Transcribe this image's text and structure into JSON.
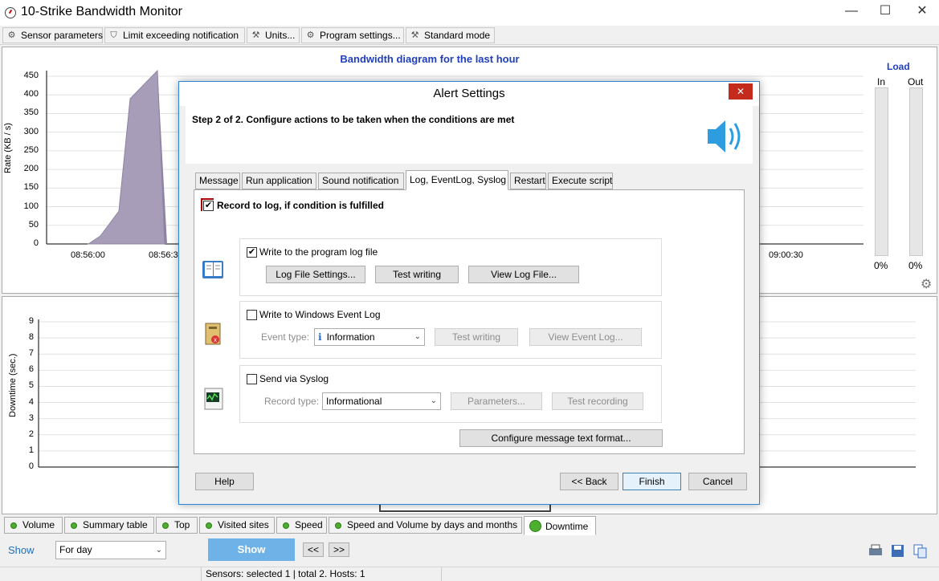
{
  "window": {
    "title": "10-Strike Bandwidth Monitor",
    "minimize": "—",
    "maximize": "☐",
    "close": "✕"
  },
  "toolbar": {
    "items": [
      {
        "label": "Sensor parameters",
        "icon": "gear-icon"
      },
      {
        "label": "Limit exceeding notification",
        "icon": "shield-icon"
      },
      {
        "label": "Units...",
        "icon": "wrench-icon"
      },
      {
        "label": "Program settings...",
        "icon": "cogs-icon"
      },
      {
        "label": "Standard mode",
        "icon": "tools-icon"
      }
    ]
  },
  "bandwidth_chart": {
    "chart_data": {
      "type": "area",
      "title": "Bandwidth diagram for the last hour",
      "ylabel": "Rate (KB / s)",
      "xlabel": "",
      "ylim": [
        0,
        450
      ],
      "yticks": [
        "450",
        "400",
        "350",
        "300",
        "250",
        "200",
        "150",
        "100",
        "50",
        "0"
      ],
      "xticks": [
        "08:56:00",
        "08:56:30",
        "09:00:30"
      ],
      "grid": true
    }
  },
  "load": {
    "title": "Load",
    "in_label": "In",
    "out_label": "Out",
    "in_value": "0%",
    "out_value": "0%",
    "in_fraction": 0,
    "out_fraction": 0
  },
  "downtime_chart": {
    "chart_data": {
      "type": "bar",
      "ylabel": "Downtime (sec.)",
      "ylim": [
        0,
        9
      ],
      "yticks": [
        "9",
        "8",
        "7",
        "6",
        "5",
        "4",
        "3",
        "2",
        "1",
        "0"
      ],
      "grid": true
    }
  },
  "dialog": {
    "title": "Alert Settings",
    "close": "✕",
    "step": "Step 2 of 2. Configure actions to be taken when the conditions are met",
    "tabs": [
      "Message",
      "Run application",
      "Sound notification",
      "Log, EventLog, Syslog",
      "Restart",
      "Execute script"
    ],
    "record_to_log": "Record to log, if condition is fulfilled",
    "program_log": {
      "label": "Write to the program log file",
      "settings": "Log File Settings...",
      "test": "Test writing",
      "view": "View Log File..."
    },
    "event_log": {
      "label": "Write to Windows Event Log",
      "type_label": "Event type:",
      "type_value": "Information",
      "test": "Test writing",
      "view": "View Event Log..."
    },
    "syslog": {
      "label": "Send via Syslog",
      "type_label": "Record type:",
      "type_value": "Informational",
      "params": "Parameters...",
      "test": "Test recording"
    },
    "configure": "Configure message text format...",
    "help": "Help",
    "back": "<< Back",
    "finish": "Finish",
    "cancel": "Cancel"
  },
  "bottom_tabs": [
    "Volume",
    "Summary table",
    "Top",
    "Visited sites",
    "Speed",
    "Speed and Volume by days and months",
    "Downtime"
  ],
  "show_bar": {
    "label": "Show",
    "period": "For day",
    "show_button": "Show",
    "prev": "<<",
    "next": ">>"
  },
  "status": {
    "text": "Sensors: selected 1 | total 2. Hosts: 1"
  },
  "colors": {
    "accent": "#1f3fbf",
    "chart_fill": "#a89db8",
    "dialog_border": "#2b87d6",
    "close_red": "#c42b1c",
    "show_button": "#6fb2e8"
  }
}
